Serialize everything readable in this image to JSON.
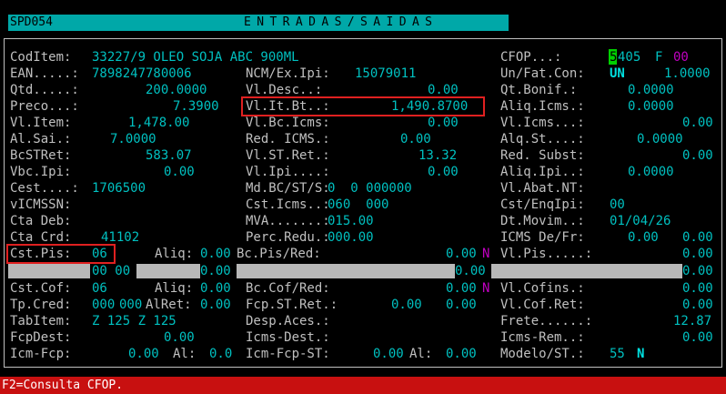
{
  "header": {
    "screen_id": "SPD054",
    "title": "ENTRADAS/SAIDAS"
  },
  "col1": [
    {
      "label": "CodItem:",
      "value": "33227/9 OLEO SOJA ABC 900ML"
    },
    {
      "label": "EAN.....:",
      "value": "7898247780006"
    },
    {
      "label": "Qtd.....:",
      "value": "200.0000"
    },
    {
      "label": "Preco...:",
      "value": "7.3900"
    },
    {
      "label": "Vl.Item:",
      "value": "1,478.00"
    },
    {
      "label": "Al.Sai.:",
      "value": "7.0000"
    },
    {
      "label": "BcSTRet:",
      "value": "583.07"
    },
    {
      "label": "Vbc.Ipi:",
      "value": "0.00"
    },
    {
      "label": "Cest....:",
      "value": "1706500"
    },
    {
      "label": "vICMSSN:",
      "value": ""
    },
    {
      "label": "Cta Deb:",
      "value": ""
    },
    {
      "label": "Cta Crd:",
      "value": "41102"
    }
  ],
  "col2": [
    {
      "label": "NCM/Ex.Ipi:",
      "value": "15079011"
    },
    {
      "label": "Vl.Desc..:",
      "value": "0.00"
    },
    {
      "label": "Vl.It.Bt..:",
      "value": "1,490.8700"
    },
    {
      "label": "Vl.Bc.Icms:",
      "value": "0.00"
    },
    {
      "label": "Red. ICMS.:",
      "value": "0.00"
    },
    {
      "label": "Vl.ST.Ret.:",
      "value": "13.32"
    },
    {
      "label": "Vl.Ipi....:",
      "value": "0.00"
    },
    {
      "label": "Md.BC/ST/S:",
      "value": "0  0 000000"
    },
    {
      "label": "Cst.Icms..:",
      "value": "060  000"
    },
    {
      "label": "MVA.......:",
      "value": "015.00"
    },
    {
      "label": "Perc.Redu.:",
      "value": "000.00"
    }
  ],
  "col3": [
    {
      "label": "Un/Fat.Con:",
      "value": "UN",
      "value2": "1.0000"
    },
    {
      "label": "Qt.Bonif.:",
      "value": "0.0000"
    },
    {
      "label": "Aliq.Icms.:",
      "value": "0.0000"
    },
    {
      "label": "Vl.Icms...:",
      "value": "0.00"
    },
    {
      "label": "Alq.St....:",
      "value": "0.0000"
    },
    {
      "label": "Red. Subst:",
      "value": "0.00"
    },
    {
      "label": "Aliq.Ipi..:",
      "value": "0.0000"
    },
    {
      "label": "Vl.Abat.NT:",
      "value": ""
    },
    {
      "label": "Cst/EnqIpi:",
      "value": "00"
    },
    {
      "label": "Dt.Movim..:",
      "value": "01/04/26"
    },
    {
      "label": "ICMS De/Fr:",
      "value": "0.00",
      "value2": "0.00"
    }
  ],
  "cfop": {
    "label": "CFOP...:",
    "cursor_char": "5",
    "rest": "405",
    "flag": "F",
    "flag2": "00"
  },
  "pis": {
    "label": "Cst.Pis:",
    "cst": "06",
    "aliq_label": "Aliq:",
    "aliq": "0.00",
    "bc_label": "Bc.Pis/Red:",
    "bc": "0.00",
    "n": "N",
    "vl_label": "Vl.Pis.....:",
    "vl": "0.00"
  },
  "grayrow": {
    "a": "00 00",
    "b": "0.00",
    "c": "0.00",
    "d": "0.00"
  },
  "cof": {
    "label": "Cst.Cof:",
    "cst": "06",
    "aliq_label": "Aliq:",
    "aliq": "0.00",
    "bc_label": "Bc.Cof/Red:",
    "bc": "0.00",
    "n": "N",
    "vl_label": "Vl.Cofins.:",
    "vl": "0.00"
  },
  "row_tp": {
    "label": "Tp.Cred:",
    "v1": "000",
    "v2": "000",
    "alret_label": "AlRet:",
    "alret": "0.00",
    "fcp_label": "Fcp.ST.Ret.:",
    "fcp": "0.00",
    "fcp2": "0.00",
    "vlcof_label": "Vl.Cof.Ret:",
    "vlcof": "0.00"
  },
  "row_tab": {
    "label": "TabItem:",
    "value": "Z 125 Z 125",
    "desp_label": "Desp.Aces.:",
    "desp": "",
    "frete_label": "Frete......:",
    "frete": "12.87"
  },
  "row_fcpdest": {
    "label": "FcpDest:",
    "value": "0.00",
    "icms_label": "Icms-Dest.:",
    "icms": "",
    "rem_label": "Icms-Rem..:",
    "rem": "0.00"
  },
  "row_icmfcp": {
    "label": "Icm-Fcp:",
    "value": "0.00",
    "al_label": "Al:",
    "al": "0.0",
    "st_label": "Icm-Fcp-ST:",
    "st": "0.00",
    "al2_label": "Al:",
    "al2": "0.00",
    "mod_label": "Modelo/ST.:",
    "mod": "55",
    "mod_n": "N"
  },
  "status": "F2=Consulta CFOP.",
  "colors": {
    "label": "#c0c0c0",
    "value": "#00c0c0",
    "highlight": "#e02020",
    "status_bg": "#c81010",
    "header_bg": "#00a8a8"
  }
}
